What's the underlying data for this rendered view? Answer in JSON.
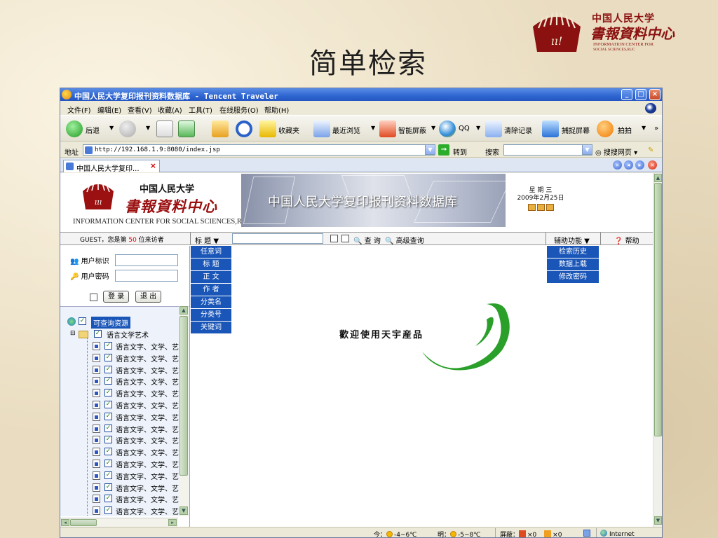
{
  "slide": {
    "title": "简单检索",
    "logo": {
      "cn_university": "中国人民大学",
      "cn_center": "書報資料中心",
      "en_line1": "INFORMATION CENTER FOR",
      "en_line2": "SOCIAL SCIENCES,RUC"
    }
  },
  "window": {
    "title": "中国人民大学复印报刊资料数据库 - Tencent Traveler",
    "controls": {
      "minimize": "_",
      "maximize": "□",
      "close": "×"
    }
  },
  "menu": [
    "文件(F)",
    "编辑(E)",
    "查看(V)",
    "收藏(A)",
    "工具(T)",
    "在线服务(O)",
    "帮助(H)"
  ],
  "toolbar": {
    "back": "后退",
    "favorites": "收藏夹",
    "recent": "最近浏览",
    "smart_block": "智能屏蔽",
    "qq": "QQ",
    "clear": "清除记录",
    "capture": "捕捉屏幕",
    "paipai": "拍拍",
    "more": "»"
  },
  "address_bar": {
    "label": "地址",
    "url": "http://192.168.1.9:8080/index.jsp",
    "go": "转到",
    "search_label": "搜索",
    "search_value": "",
    "search_web": "搜搜网页"
  },
  "tabs": [
    {
      "label": "中国人民大学复印..."
    }
  ],
  "page": {
    "logo": {
      "cn_university": "中国人民大学",
      "cn_center": "書報資料中心",
      "en": "INFORMATION CENTER FOR SOCIAL SCIENCES,RUC"
    },
    "banner_title": "中国人民大学复印报刊资料数据库",
    "date": {
      "weekday": "星 期 三",
      "date": "2009年2月25日"
    },
    "visitor": {
      "prefix": "GUEST，您是第",
      "count": "50",
      "suffix": "位来访者"
    },
    "search": {
      "field_selected": "标 题",
      "query": "",
      "search_btn": "查 询",
      "advanced_btn": "高级查询"
    },
    "field_options": [
      "任意词",
      "标 题",
      "正 文",
      "作 者",
      "分类名",
      "分类号",
      "关键词"
    ],
    "aux": {
      "label": "辅助功能",
      "options": [
        "检索历史",
        "数据上载",
        "修改密码"
      ]
    },
    "help": "帮助",
    "login": {
      "user_label": "用户标识",
      "user_value": "",
      "pass_label": "用户密码",
      "pass_value": "",
      "login_btn": "登 录",
      "logout_btn": "退 出"
    },
    "tree": {
      "root": "可查询资源",
      "folder": "语言文学艺术",
      "items": [
        "语言文字、文学、艺",
        "语言文字、文学、艺",
        "语言文字、文学、艺",
        "语言文字、文学、艺",
        "语言文字、文学、艺",
        "语言文字、文学、艺",
        "语言文字、文学、艺",
        "语言文字、文学、艺",
        "语言文字、文学、艺",
        "语言文字、文学、艺",
        "语言文字、文学、艺",
        "语言文字、文学、艺",
        "语言文字、文学、艺",
        "语言文字、文学、艺",
        "语言文字、文学、艺",
        "语言文字、文学、艺"
      ]
    },
    "welcome": "歡迎使用天宇産品"
  },
  "status": {
    "today": "今：",
    "today_temp": "-4~6℃",
    "tomorrow": "明：",
    "tomorrow_temp": "-5~8℃",
    "block_label": "屏蔽：",
    "block_count1": "×0",
    "block_count2": "×0",
    "zone": "Internet"
  },
  "colors": {
    "accent_blue": "#1a56b8",
    "brand_red": "#9b1010",
    "logo_green": "#2aa02a",
    "title_bar": "#2f66d0"
  }
}
